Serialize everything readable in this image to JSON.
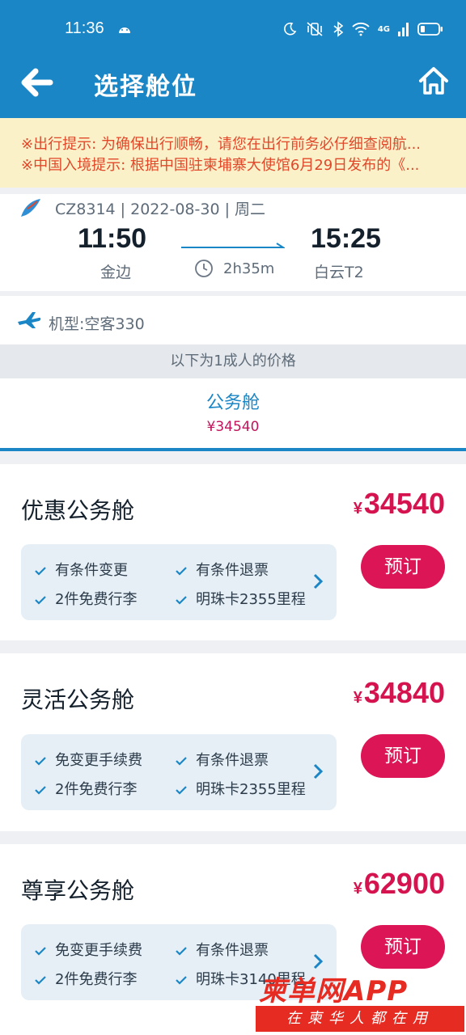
{
  "status_bar": {
    "time": "11:36",
    "network": "4G"
  },
  "header": {
    "title": "选择舱位"
  },
  "notices": [
    "※出行提示: 为确保出行顺畅，请您在出行前务必仔细查阅航...",
    "※中国入境提示: 根据中国驻柬埔寨大使馆6月29日发布的《..."
  ],
  "flight": {
    "meta": "CZ8314 | 2022-08-30 | 周二",
    "dep_time": "11:50",
    "dep_airport": "金边",
    "arr_time": "15:25",
    "arr_airport": "白云T2",
    "duration": "2h35m"
  },
  "aircraft": {
    "label": "机型:空客330"
  },
  "price_hint": "以下为1成人的价格",
  "cabin_tab": {
    "name": "公务舱",
    "price": "¥34540"
  },
  "fares": [
    {
      "name": "优惠公务舱",
      "currency": "¥",
      "price": "34540",
      "perks": [
        "有条件变更",
        "有条件退票",
        "2件免费行李",
        "明珠卡2355里程"
      ],
      "book": "预订"
    },
    {
      "name": "灵活公务舱",
      "currency": "¥",
      "price": "34840",
      "perks": [
        "免变更手续费",
        "有条件退票",
        "2件免费行李",
        "明珠卡2355里程"
      ],
      "book": "预订"
    },
    {
      "name": "尊享公务舱",
      "currency": "¥",
      "price": "62900",
      "perks": [
        "免变更手续费",
        "有条件退票",
        "2件免费行李",
        "明珠卡3140里程"
      ],
      "book": "预订"
    }
  ],
  "watermark": {
    "logo": "柬单网APP",
    "slogan": "在柬华人都在用"
  },
  "colors": {
    "header": "#1a86c6",
    "accent_price": "#d4134f",
    "book_button": "#db1556",
    "notice_text": "#e0482a"
  }
}
